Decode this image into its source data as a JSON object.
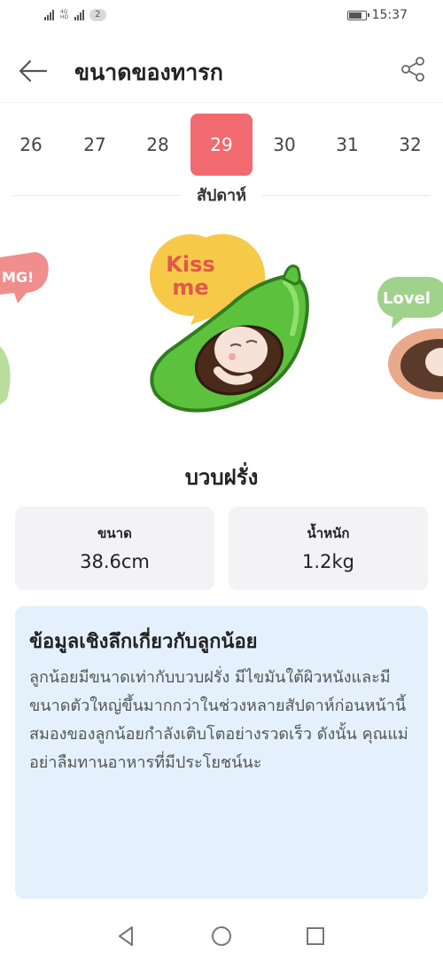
{
  "status_bar": {
    "network_label_top": "4G",
    "network_label_bottom": "HD",
    "sim_count": "2",
    "time": "15:37",
    "battery_level": 0.8
  },
  "header": {
    "title": "ขนาดของทารก"
  },
  "weeks": {
    "items": [
      "26",
      "27",
      "28",
      "29",
      "30",
      "31",
      "32"
    ],
    "selected": "29",
    "label": "สัปดาห์"
  },
  "carousel": {
    "left_bubble_text": "MG!",
    "main_bubble_text_line1": "Kiss",
    "main_bubble_text_line2": "me",
    "right_bubble_text": "Lovel",
    "colors": {
      "bubble_yellow": "#f7c948",
      "bubble_pink": "#f08d8d",
      "bubble_green": "#9fd28a",
      "gourd_green": "#5cc13c",
      "gourd_dark": "#2f7d1f"
    }
  },
  "fruit": {
    "name": "บวบฝรั่ง"
  },
  "stats": {
    "size_label": "ขนาด",
    "size_value": "38.6cm",
    "weight_label": "น้ำหนัก",
    "weight_value": "1.2kg"
  },
  "insight": {
    "title": "ข้อมูลเชิงลึกเกี่ยวกับลูกน้อย",
    "body": "ลูกน้อยมีขนาดเท่ากับบวบฝรั่ง มีไขมันใต้ผิวหนังและมีขนาดตัวใหญ่ขึ้นมากกว่าในช่วงหลายสัปดาห์ก่อนหน้านี้ สมองของลูกน้อยกำลังเติบโตอย่างรวดเร็ว ดังนั้น คุณแม่อย่าลืมทานอาหารที่มีประโยชน์นะ"
  },
  "nav": {
    "icons": [
      "back-triangle-icon",
      "home-circle-icon",
      "recents-square-icon"
    ]
  },
  "theme": {
    "accent": "#f16a6f",
    "card_bg": "#f3f3f5",
    "insight_bg": "#e4f1fc"
  }
}
